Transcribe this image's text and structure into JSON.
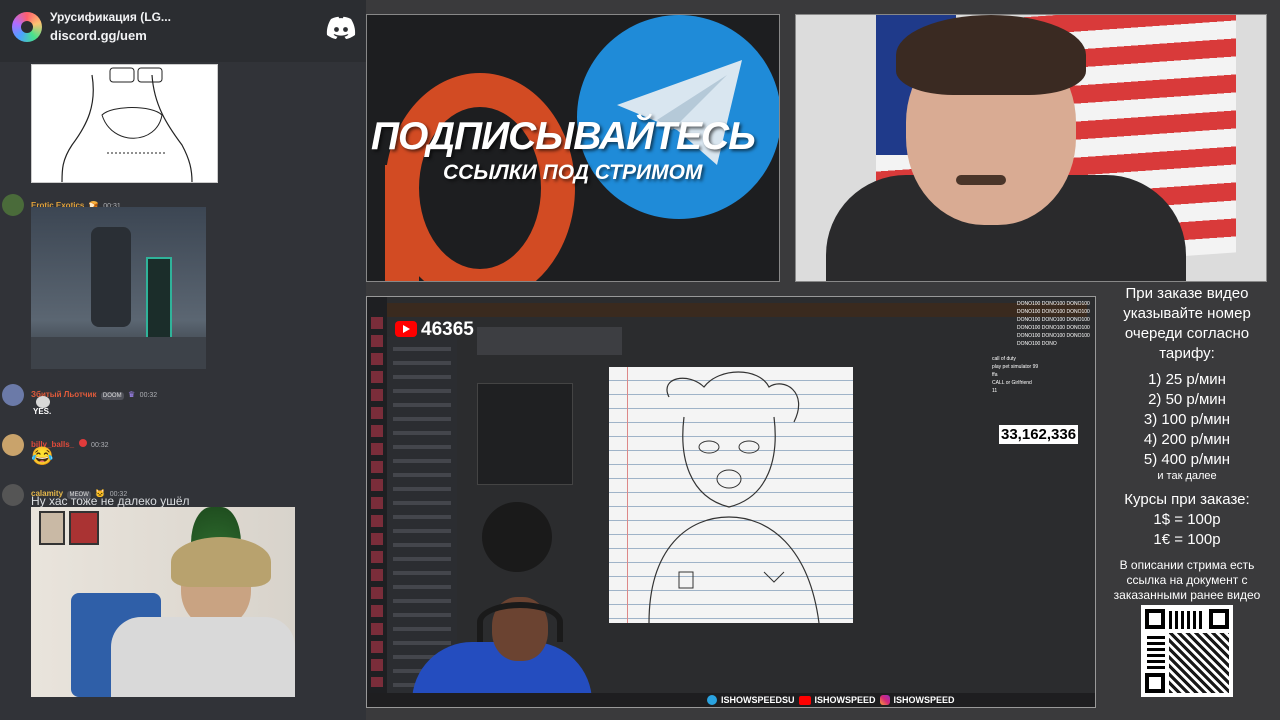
{
  "discord": {
    "server_title": "Урусификация (LG...",
    "invite_link": "discord.gg/uem",
    "messages": [
      {
        "user": "Erotic Exotics",
        "user_color": "#e0a13b",
        "time": "00:31"
      },
      {
        "user": "Збитый Льотчик",
        "user_color": "#e05b3b",
        "badge": "DOOM",
        "time": "00:32",
        "emoji_text": "YES."
      },
      {
        "user": "billy_balls_",
        "user_color": "#e04b3b",
        "time": "00:32",
        "emoji": "😂"
      },
      {
        "user": "calamity",
        "user_color": "#e6b84a",
        "badge": "MEOW",
        "time": "00:32",
        "text": "Ну хас тоже не далеко ушёл"
      }
    ]
  },
  "promo": {
    "headline": "ПОДПИСЫВАЙТЕСЬ",
    "subline": "ССЫЛКИ ПОД СТРИМОМ"
  },
  "main_video": {
    "yt_count": "46365",
    "total_count": "33,162,336",
    "ticker": [
      "DONO100 DONO100 DONO100",
      "DONO100 DONO100 DONO100",
      "DONO100 DONO100 DONO100",
      "DONO100 DONO100 DONO100",
      "DONO100 DONO100 DONO100",
      "DONO100 DONO"
    ],
    "chat_lines": [
      "call of duty",
      "play pet simulator 99",
      "ffa",
      "CALL or Girlfriend",
      "11"
    ],
    "social_bar": [
      "ISHOWSPEEDSU",
      "ISHOWSPEED",
      "ISHOWSPEED"
    ]
  },
  "price": {
    "intro": "При заказе видео указывайте номер очереди согласно тарифу:",
    "tiers": [
      "1) 25 р/мин",
      "2) 50 р/мин",
      "3) 100 р/мин",
      "4) 200 р/мин",
      "5) 400 р/мин"
    ],
    "more": "и так далее",
    "rates_title": "Курсы при заказе:",
    "rates": [
      "1$ = 100р",
      "1€ = 100р"
    ],
    "desc": "В описании стрима есть ссылка на документ с заказанными ранее видео"
  }
}
